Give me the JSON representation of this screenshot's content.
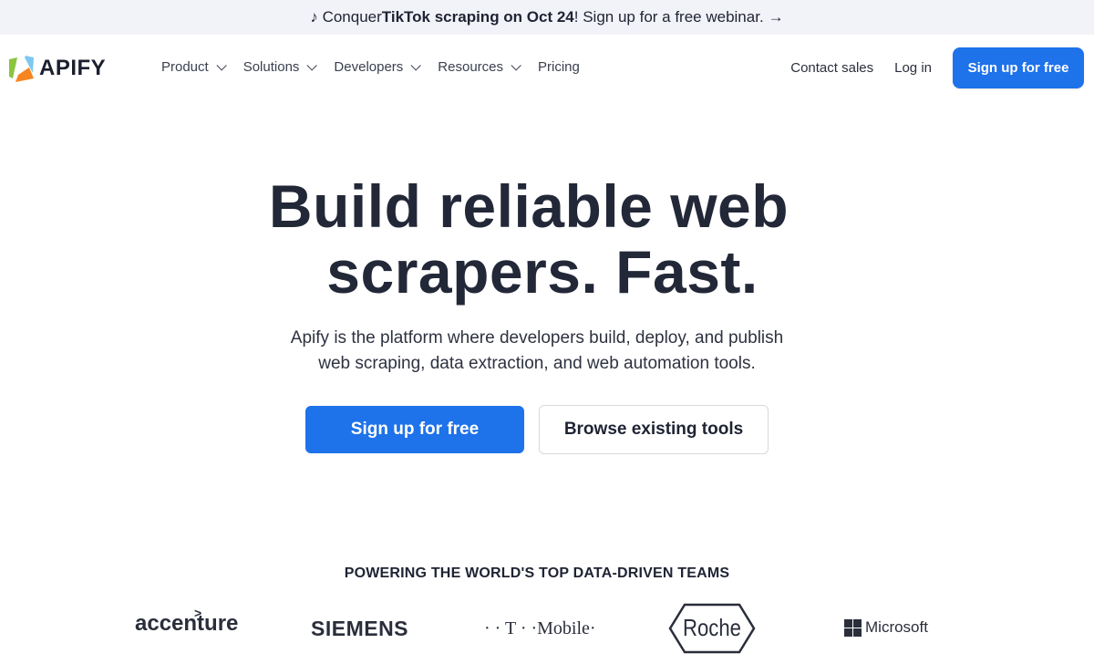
{
  "banner": {
    "icon": "music-note-icon",
    "prefix": "Conquer ",
    "bold": "TikTok scraping on Oct 24",
    "suffix": "! Sign up for a free webinar.",
    "arrow": "→"
  },
  "nav": {
    "logo_text": "APIFY",
    "menu": [
      {
        "label": "Product",
        "dropdown": true
      },
      {
        "label": "Solutions",
        "dropdown": true
      },
      {
        "label": "Developers",
        "dropdown": true
      },
      {
        "label": "Resources",
        "dropdown": true
      },
      {
        "label": "Pricing",
        "dropdown": false
      }
    ],
    "contact_sales": "Contact sales",
    "log_in": "Log in",
    "cta": "Sign up for free"
  },
  "hero": {
    "title_line1": "Build reliable web",
    "title_line2": "scrapers. Fast.",
    "subtitle_line1": "Apify is the platform where developers build, deploy, and publish",
    "subtitle_line2": "web scraping, data extraction, and web automation tools.",
    "primary_button": "Sign up for free",
    "secondary_button": "Browse existing tools"
  },
  "clients": {
    "heading": "POWERING THE WORLD'S TOP DATA-DRIVEN TEAMS",
    "logos": [
      {
        "name": "accenture",
        "text": "accenture",
        "caret": ">"
      },
      {
        "name": "siemens",
        "text": "SIEMENS"
      },
      {
        "name": "t-mobile",
        "text": "· · T · ·Mobile·"
      },
      {
        "name": "roche",
        "text": "Roche"
      },
      {
        "name": "microsoft",
        "text": "Microsoft"
      }
    ]
  },
  "colors": {
    "brand_blue": "#1e72ea",
    "banner_bg": "#f2f3f8",
    "text_dark": "#232838",
    "logo_green": "#8bc53f",
    "logo_orange": "#f7851f",
    "logo_blue": "#7dc8ee"
  }
}
